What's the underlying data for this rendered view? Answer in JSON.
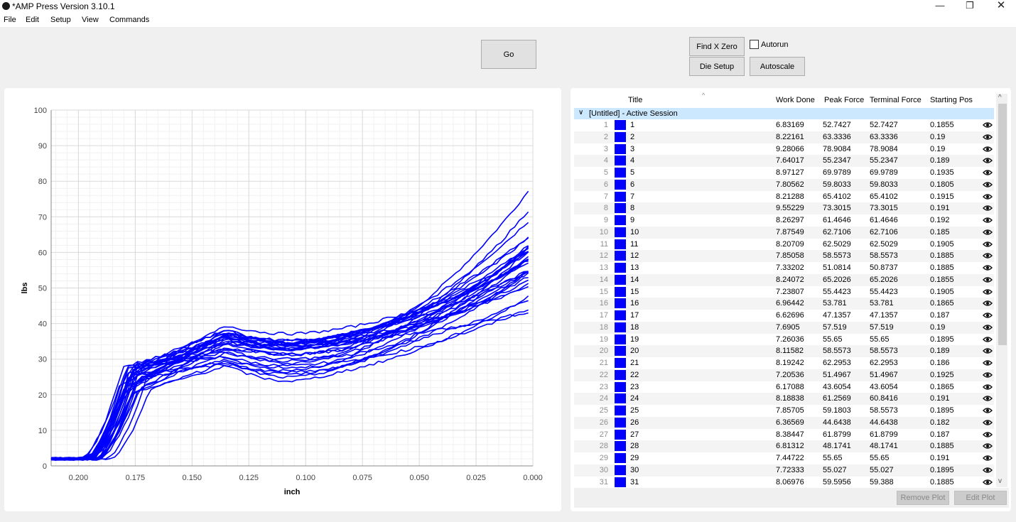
{
  "window": {
    "title": "*AMP Press Version 3.10.1",
    "min": "—",
    "max": "❐",
    "close": "✕"
  },
  "menu": [
    "File",
    "Edit",
    "Setup",
    "View",
    "Commands"
  ],
  "toolbar": {
    "go": "Go",
    "find_x_zero": "Find X Zero",
    "autorun": "Autorun",
    "autorun_checked": false,
    "die_setup": "Die Setup",
    "autoscale": "Autoscale"
  },
  "chart_data": {
    "type": "line",
    "xlabel": "inch",
    "ylabel": "lbs",
    "xlim": [
      0.212,
      0.0
    ],
    "ylim": [
      0,
      100
    ],
    "x_reversed": true,
    "x_ticks": [
      "0.200",
      "0.175",
      "0.150",
      "0.125",
      "0.100",
      "0.075",
      "0.050",
      "0.025",
      "0.000"
    ],
    "y_ticks": [
      "0",
      "10",
      "20",
      "30",
      "40",
      "50",
      "60",
      "70",
      "80",
      "90",
      "100"
    ],
    "grid": true,
    "color": "#0000ff",
    "series_note_peak_at_end": [
      52.7427,
      63.3336,
      78.9084,
      55.2347,
      69.9789,
      59.8033,
      65.4102,
      73.3015,
      61.4646,
      62.7106,
      62.5029,
      58.5573,
      50.8737,
      65.2026,
      55.4423,
      53.781,
      47.1357,
      57.519,
      55.65,
      58.5573,
      62.2953,
      51.4967,
      43.6054,
      60.8416,
      58.5573,
      44.6438,
      61.8799,
      48.1741,
      55.65,
      55.027,
      59.388
    ],
    "series_start_pos": [
      0.1855,
      0.19,
      0.19,
      0.189,
      0.1935,
      0.1805,
      0.1915,
      0.191,
      0.192,
      0.185,
      0.1905,
      0.1885,
      0.1885,
      0.1855,
      0.1905,
      0.1865,
      0.187,
      0.19,
      0.1895,
      0.189,
      0.186,
      0.1925,
      0.1865,
      0.191,
      0.1895,
      0.182,
      0.187,
      0.1885,
      0.191,
      0.1895,
      0.1885
    ]
  },
  "table": {
    "columns": [
      "Title",
      "Work Done",
      "Peak Force",
      "Terminal Force",
      "Starting Pos"
    ],
    "sort_indicator": "^",
    "group_chevron": "∨",
    "group_label": "[Untitled] - Active Session",
    "rows": [
      {
        "n": "1",
        "title": "1",
        "work": "6.83169",
        "peak": "52.7427",
        "term": "52.7427",
        "start": "0.1855"
      },
      {
        "n": "2",
        "title": "2",
        "work": "8.22161",
        "peak": "63.3336",
        "term": "63.3336",
        "start": "0.19"
      },
      {
        "n": "3",
        "title": "3",
        "work": "9.28066",
        "peak": "78.9084",
        "term": "78.9084",
        "start": "0.19"
      },
      {
        "n": "4",
        "title": "4",
        "work": "7.64017",
        "peak": "55.2347",
        "term": "55.2347",
        "start": "0.189"
      },
      {
        "n": "5",
        "title": "5",
        "work": "8.97127",
        "peak": "69.9789",
        "term": "69.9789",
        "start": "0.1935"
      },
      {
        "n": "6",
        "title": "6",
        "work": "7.80562",
        "peak": "59.8033",
        "term": "59.8033",
        "start": "0.1805"
      },
      {
        "n": "7",
        "title": "7",
        "work": "8.21288",
        "peak": "65.4102",
        "term": "65.4102",
        "start": "0.1915"
      },
      {
        "n": "8",
        "title": "8",
        "work": "9.55229",
        "peak": "73.3015",
        "term": "73.3015",
        "start": "0.191"
      },
      {
        "n": "9",
        "title": "9",
        "work": "8.26297",
        "peak": "61.4646",
        "term": "61.4646",
        "start": "0.192"
      },
      {
        "n": "10",
        "title": "10",
        "work": "7.87549",
        "peak": "62.7106",
        "term": "62.7106",
        "start": "0.185"
      },
      {
        "n": "11",
        "title": "11",
        "work": "8.20709",
        "peak": "62.5029",
        "term": "62.5029",
        "start": "0.1905"
      },
      {
        "n": "12",
        "title": "12",
        "work": "7.85058",
        "peak": "58.5573",
        "term": "58.5573",
        "start": "0.1885"
      },
      {
        "n": "13",
        "title": "13",
        "work": "7.33202",
        "peak": "51.0814",
        "term": "50.8737",
        "start": "0.1885"
      },
      {
        "n": "14",
        "title": "14",
        "work": "8.24072",
        "peak": "65.2026",
        "term": "65.2026",
        "start": "0.1855"
      },
      {
        "n": "15",
        "title": "15",
        "work": "7.23807",
        "peak": "55.4423",
        "term": "55.4423",
        "start": "0.1905"
      },
      {
        "n": "16",
        "title": "16",
        "work": "6.96442",
        "peak": "53.781",
        "term": "53.781",
        "start": "0.1865"
      },
      {
        "n": "17",
        "title": "17",
        "work": "6.62696",
        "peak": "47.1357",
        "term": "47.1357",
        "start": "0.187"
      },
      {
        "n": "18",
        "title": "18",
        "work": "7.6905",
        "peak": "57.519",
        "term": "57.519",
        "start": "0.19"
      },
      {
        "n": "19",
        "title": "19",
        "work": "7.26036",
        "peak": "55.65",
        "term": "55.65",
        "start": "0.1895"
      },
      {
        "n": "20",
        "title": "20",
        "work": "8.11582",
        "peak": "58.5573",
        "term": "58.5573",
        "start": "0.189"
      },
      {
        "n": "21",
        "title": "21",
        "work": "8.19242",
        "peak": "62.2953",
        "term": "62.2953",
        "start": "0.186"
      },
      {
        "n": "22",
        "title": "22",
        "work": "7.20536",
        "peak": "51.4967",
        "term": "51.4967",
        "start": "0.1925"
      },
      {
        "n": "23",
        "title": "23",
        "work": "6.17088",
        "peak": "43.6054",
        "term": "43.6054",
        "start": "0.1865"
      },
      {
        "n": "24",
        "title": "24",
        "work": "8.18838",
        "peak": "61.2569",
        "term": "60.8416",
        "start": "0.191"
      },
      {
        "n": "25",
        "title": "25",
        "work": "7.85705",
        "peak": "59.1803",
        "term": "58.5573",
        "start": "0.1895"
      },
      {
        "n": "26",
        "title": "26",
        "work": "6.36569",
        "peak": "44.6438",
        "term": "44.6438",
        "start": "0.182"
      },
      {
        "n": "27",
        "title": "27",
        "work": "8.38447",
        "peak": "61.8799",
        "term": "61.8799",
        "start": "0.187"
      },
      {
        "n": "28",
        "title": "28",
        "work": "6.81312",
        "peak": "48.1741",
        "term": "48.1741",
        "start": "0.1885"
      },
      {
        "n": "29",
        "title": "29",
        "work": "7.44722",
        "peak": "55.65",
        "term": "55.65",
        "start": "0.191"
      },
      {
        "n": "30",
        "title": "30",
        "work": "7.72333",
        "peak": "55.027",
        "term": "55.027",
        "start": "0.1895"
      },
      {
        "n": "31",
        "title": "31",
        "work": "8.06976",
        "peak": "59.5956",
        "term": "59.388",
        "start": "0.1885"
      }
    ],
    "remove_plot": "Remove Plot",
    "edit_plot": "Edit Plot",
    "scroll_up": "^",
    "scroll_down": "v"
  },
  "icons": {
    "app": "amp-app-icon",
    "visibility": "eye-icon"
  }
}
